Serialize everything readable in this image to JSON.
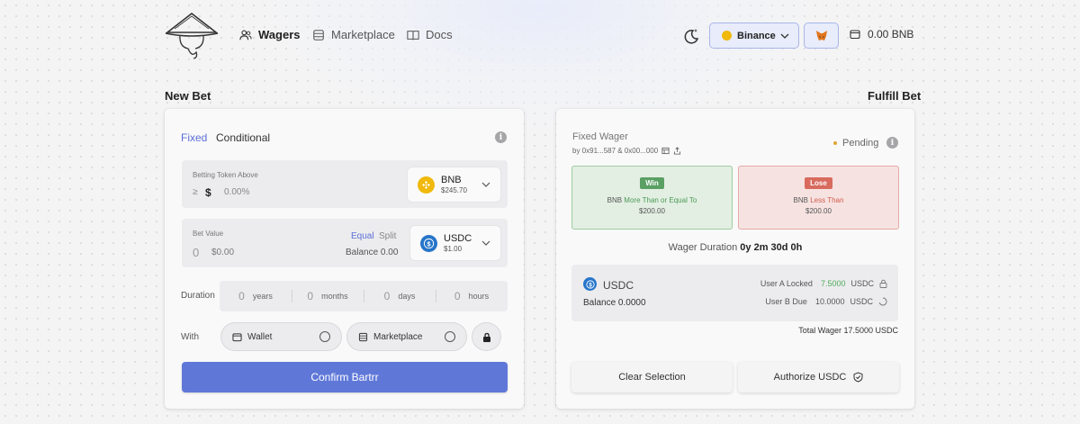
{
  "header": {
    "nav": [
      {
        "label": "Wagers",
        "icon": "users-icon",
        "active": true
      },
      {
        "label": "Marketplace",
        "icon": "stack-icon"
      },
      {
        "label": "Docs",
        "icon": "book-icon"
      }
    ],
    "network": "Binance",
    "balance": "0.00 BNB"
  },
  "new_bet": {
    "title": "New Bet",
    "tabs": [
      "Fixed",
      "Conditional"
    ],
    "betting_token": {
      "label": "Betting Token Above",
      "comparator": "≥",
      "currency_symbol": "$",
      "placeholder": "0.00%",
      "token": "BNB",
      "price": "$245.70"
    },
    "bet_value": {
      "label": "Bet Value",
      "amount_placeholder": "0",
      "usd_placeholder": "$0.00",
      "mode_equal": "Equal",
      "mode_split": "Split",
      "balance": "Balance 0.00",
      "token": "USDC",
      "price": "$1.00"
    },
    "duration": {
      "label": "Duration",
      "units": [
        {
          "value": "0",
          "unit": "years"
        },
        {
          "value": "0",
          "unit": "months"
        },
        {
          "value": "0",
          "unit": "days"
        },
        {
          "value": "0",
          "unit": "hours"
        }
      ]
    },
    "with": {
      "label": "With",
      "options": [
        "Wallet",
        "Marketplace"
      ]
    },
    "confirm_label": "Confirm Bartrr"
  },
  "fulfill_bet": {
    "title": "Fulfill Bet",
    "wager_title": "Fixed Wager",
    "wager_by": "by 0x91...587 & 0x00...000",
    "status": "Pending",
    "win": {
      "badge": "Win",
      "token": "BNB",
      "condition": "More Than or Equal To",
      "amount": "$200.00"
    },
    "lose": {
      "badge": "Lose",
      "token": "BNB",
      "condition": "Less Than",
      "amount": "$200.00"
    },
    "duration_label": "Wager Duration",
    "duration_value": "0y 2m 30d 0h",
    "token_box": {
      "token": "USDC",
      "balance": "Balance 0.0000",
      "user_a_label": "User A Locked",
      "user_a_value": "7.5000",
      "user_a_unit": "USDC",
      "user_b_label": "User B Due",
      "user_b_value": "10.0000",
      "user_b_unit": "USDC"
    },
    "total": "Total Wager 17.5000 USDC",
    "clear_label": "Clear Selection",
    "authorize_label": "Authorize USDC"
  },
  "colors": {
    "accent": "#5f78d8",
    "win": "#5aa064",
    "lose": "#d86b5e",
    "bnb": "#f0b90b",
    "usdc": "#2775ca"
  }
}
